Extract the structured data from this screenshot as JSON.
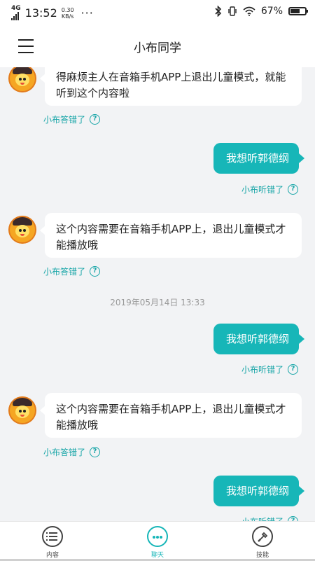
{
  "status_bar": {
    "network": "4G",
    "time": "13:52",
    "speed_value": "0.30",
    "speed_unit": "KB/s",
    "more": "···",
    "battery": "67%",
    "battery_level": 0.67
  },
  "header": {
    "title": "小布同学"
  },
  "chat": {
    "messages": [
      {
        "side": "left",
        "text": "得麻烦主人在音箱手机APP上退出儿童模式，就能听到这个内容啦",
        "feedback": "小布答错了"
      },
      {
        "side": "right",
        "text": "我想听郭德纲",
        "feedback": "小布听错了"
      },
      {
        "side": "left",
        "text": "这个内容需要在音箱手机APP上，退出儿童模式才能播放哦",
        "feedback": "小布答错了"
      },
      {
        "side": "right",
        "text": "我想听郭德纲",
        "feedback": "小布听错了"
      },
      {
        "side": "left",
        "text": "这个内容需要在音箱手机APP上，退出儿童模式才能播放哦",
        "feedback": "小布答错了"
      },
      {
        "side": "right",
        "text": "我想听郭德纲",
        "feedback": "小布听错了"
      }
    ],
    "timestamp": "2019年05月14日 13:33"
  },
  "tabs": [
    {
      "label": "内容",
      "icon": "list-icon"
    },
    {
      "label": "聊天",
      "icon": "chat-icon",
      "active": true
    },
    {
      "label": "技能",
      "icon": "skill-icon"
    }
  ],
  "colors": {
    "accent": "#17b6b8",
    "feedback": "#17a5a7",
    "background": "#f2f3f5"
  }
}
